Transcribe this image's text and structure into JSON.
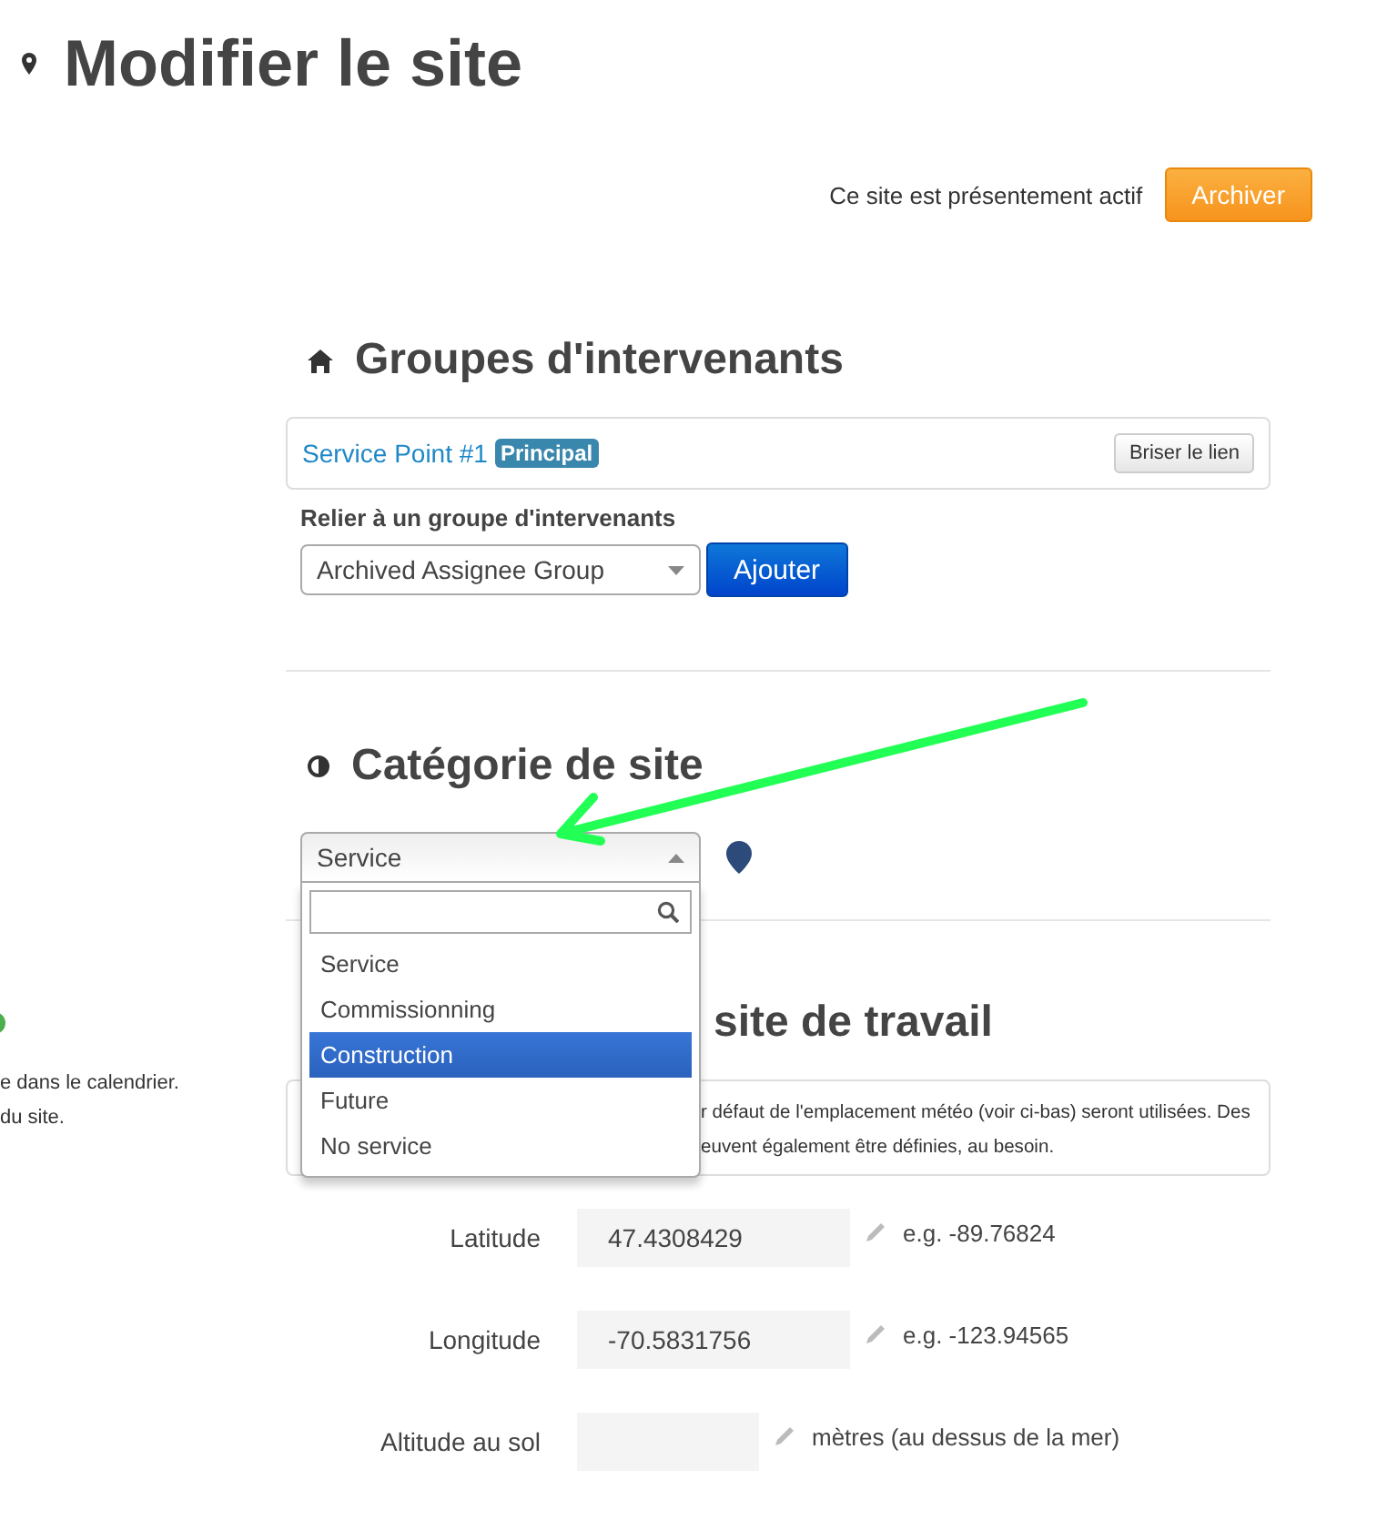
{
  "page_title": "Modifier le site",
  "status": {
    "text": "Ce site est présentement actif",
    "button": "Archiver"
  },
  "sidebar": {
    "lines": [
      "e dans le calendrier.",
      "du site."
    ]
  },
  "assignee_groups": {
    "title": "Groupes d'intervenants",
    "linked": [
      {
        "name": "Service Point #1",
        "badge": "Principal",
        "action": "Briser le lien"
      }
    ],
    "link_label": "Relier à un groupe d'intervenants",
    "select": {
      "value": "Archived Assignee Group"
    },
    "add_button": "Ajouter"
  },
  "site_category": {
    "title": "Catégorie de site",
    "select": {
      "value": "Service",
      "expanded": true
    },
    "options": [
      {
        "label": "Service",
        "selected": false
      },
      {
        "label": "Commissionning",
        "selected": false
      },
      {
        "label": "Construction",
        "selected": true
      },
      {
        "label": "Future",
        "selected": false
      },
      {
        "label": "No service",
        "selected": false
      }
    ]
  },
  "work_site": {
    "title": "site de travail",
    "info_lines": [
      "r défaut de l'emplacement météo (voir ci-bas) seront utilisées. Des",
      "euvent également être définies, au besoin."
    ],
    "fields": [
      {
        "kind": "coordinate",
        "label": "Latitude",
        "value": "47.4308429",
        "hint": "e.g. -89.76824"
      },
      {
        "kind": "coordinate",
        "label": "Longitude",
        "value": "-70.5831756",
        "hint": "e.g. -123.94565"
      },
      {
        "kind": "altitude",
        "label": "Altitude au sol",
        "hint": "mètres (au dessus de la mer)"
      }
    ]
  }
}
